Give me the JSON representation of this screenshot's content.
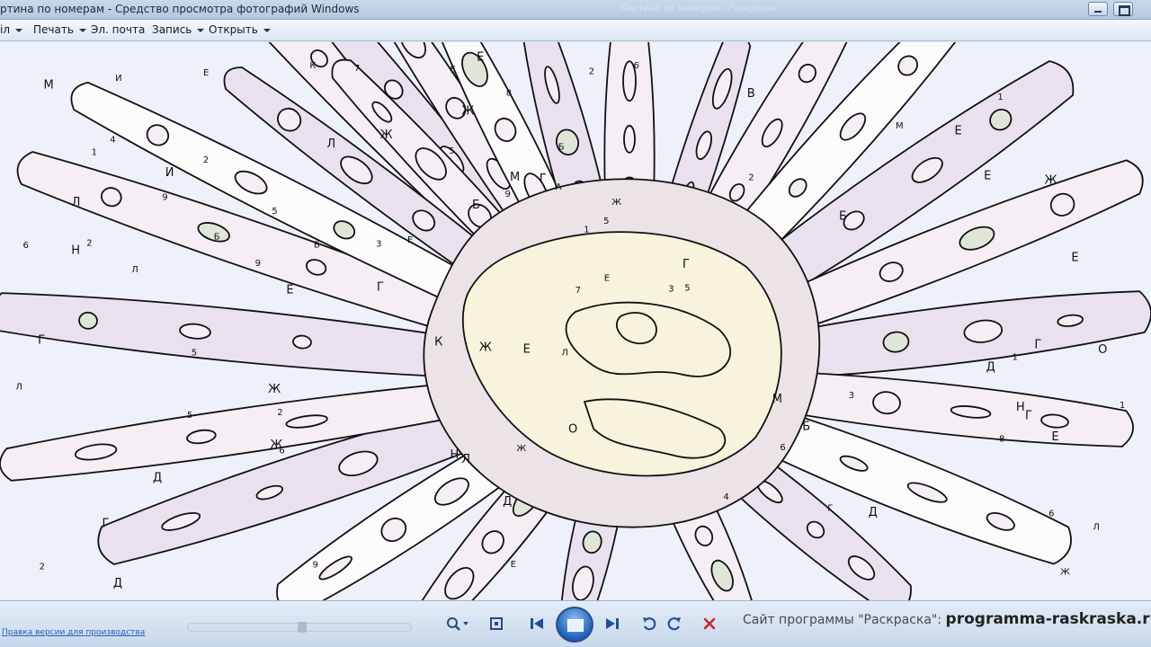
{
  "window": {
    "title": "ртина по номерам - Средство просмотра фотографий Windows",
    "title_ghost": "Картина по номерам - Раскраска"
  },
  "menu": {
    "items": [
      {
        "label": "іл",
        "has_caret": true
      },
      {
        "label": "Печать",
        "has_caret": true
      },
      {
        "label": "Эл. почта",
        "has_caret": false
      },
      {
        "label": "Запись",
        "has_caret": true
      },
      {
        "label": "Открыть",
        "has_caret": true
      }
    ]
  },
  "canvas": {
    "labels": [
      "Л",
      "Е",
      "Г",
      "Б",
      "В",
      "2",
      "5",
      "Б",
      "Ж",
      "Е",
      "Ж",
      "Л",
      "М",
      "Ж",
      "Е",
      "Ж",
      "Г",
      "Л",
      "И",
      "И",
      "М",
      "Г",
      "Д",
      "9",
      "6",
      "9",
      "Д",
      "6",
      "3",
      "6",
      "3",
      "9",
      "6",
      "9",
      "6",
      "3",
      "Д",
      "Д",
      "Д",
      "К",
      "Б",
      "Е",
      "Е",
      "Г",
      "Е",
      "Л",
      "2",
      "5",
      "М",
      "Л",
      "Ж",
      "Е",
      "Ж",
      "Е",
      "Б",
      "1",
      "1",
      "7",
      "5",
      "К",
      "Е",
      "Н",
      "Г",
      "Л",
      "О",
      "Г",
      "4",
      "8",
      "О",
      "Н",
      "7",
      "8",
      "Н",
      "1",
      "5",
      "2",
      "5",
      "2",
      "2",
      "5",
      "2",
      "Б",
      "Г",
      "Б",
      "1",
      "4",
      "А",
      "1",
      "М",
      "Е",
      "Л",
      "Е",
      "Г",
      "Ж",
      "Ж",
      "Ж",
      "Е"
    ],
    "brand_colors": {
      "region_fill": "#f5eef5",
      "petal_fill": "#e9e2ee",
      "center_fill": "#f7f3dc",
      "ring_fill": "#ece3e6",
      "green_fill": "#dfe6d8",
      "white_fill": "#fbfbfb",
      "outline": "#111111"
    }
  },
  "bottom": {
    "help_link": "Правка версии для производства",
    "site_label": "Сайт программы \"Раскраска\":",
    "site_url": "programma-raskraska.ru"
  },
  "icons": [
    "zoom-icon",
    "actual-size-icon",
    "previous-icon",
    "slideshow-icon",
    "next-icon",
    "rotate-left-icon",
    "rotate-right-icon",
    "delete-icon",
    "minimize-icon",
    "maximize-icon"
  ]
}
